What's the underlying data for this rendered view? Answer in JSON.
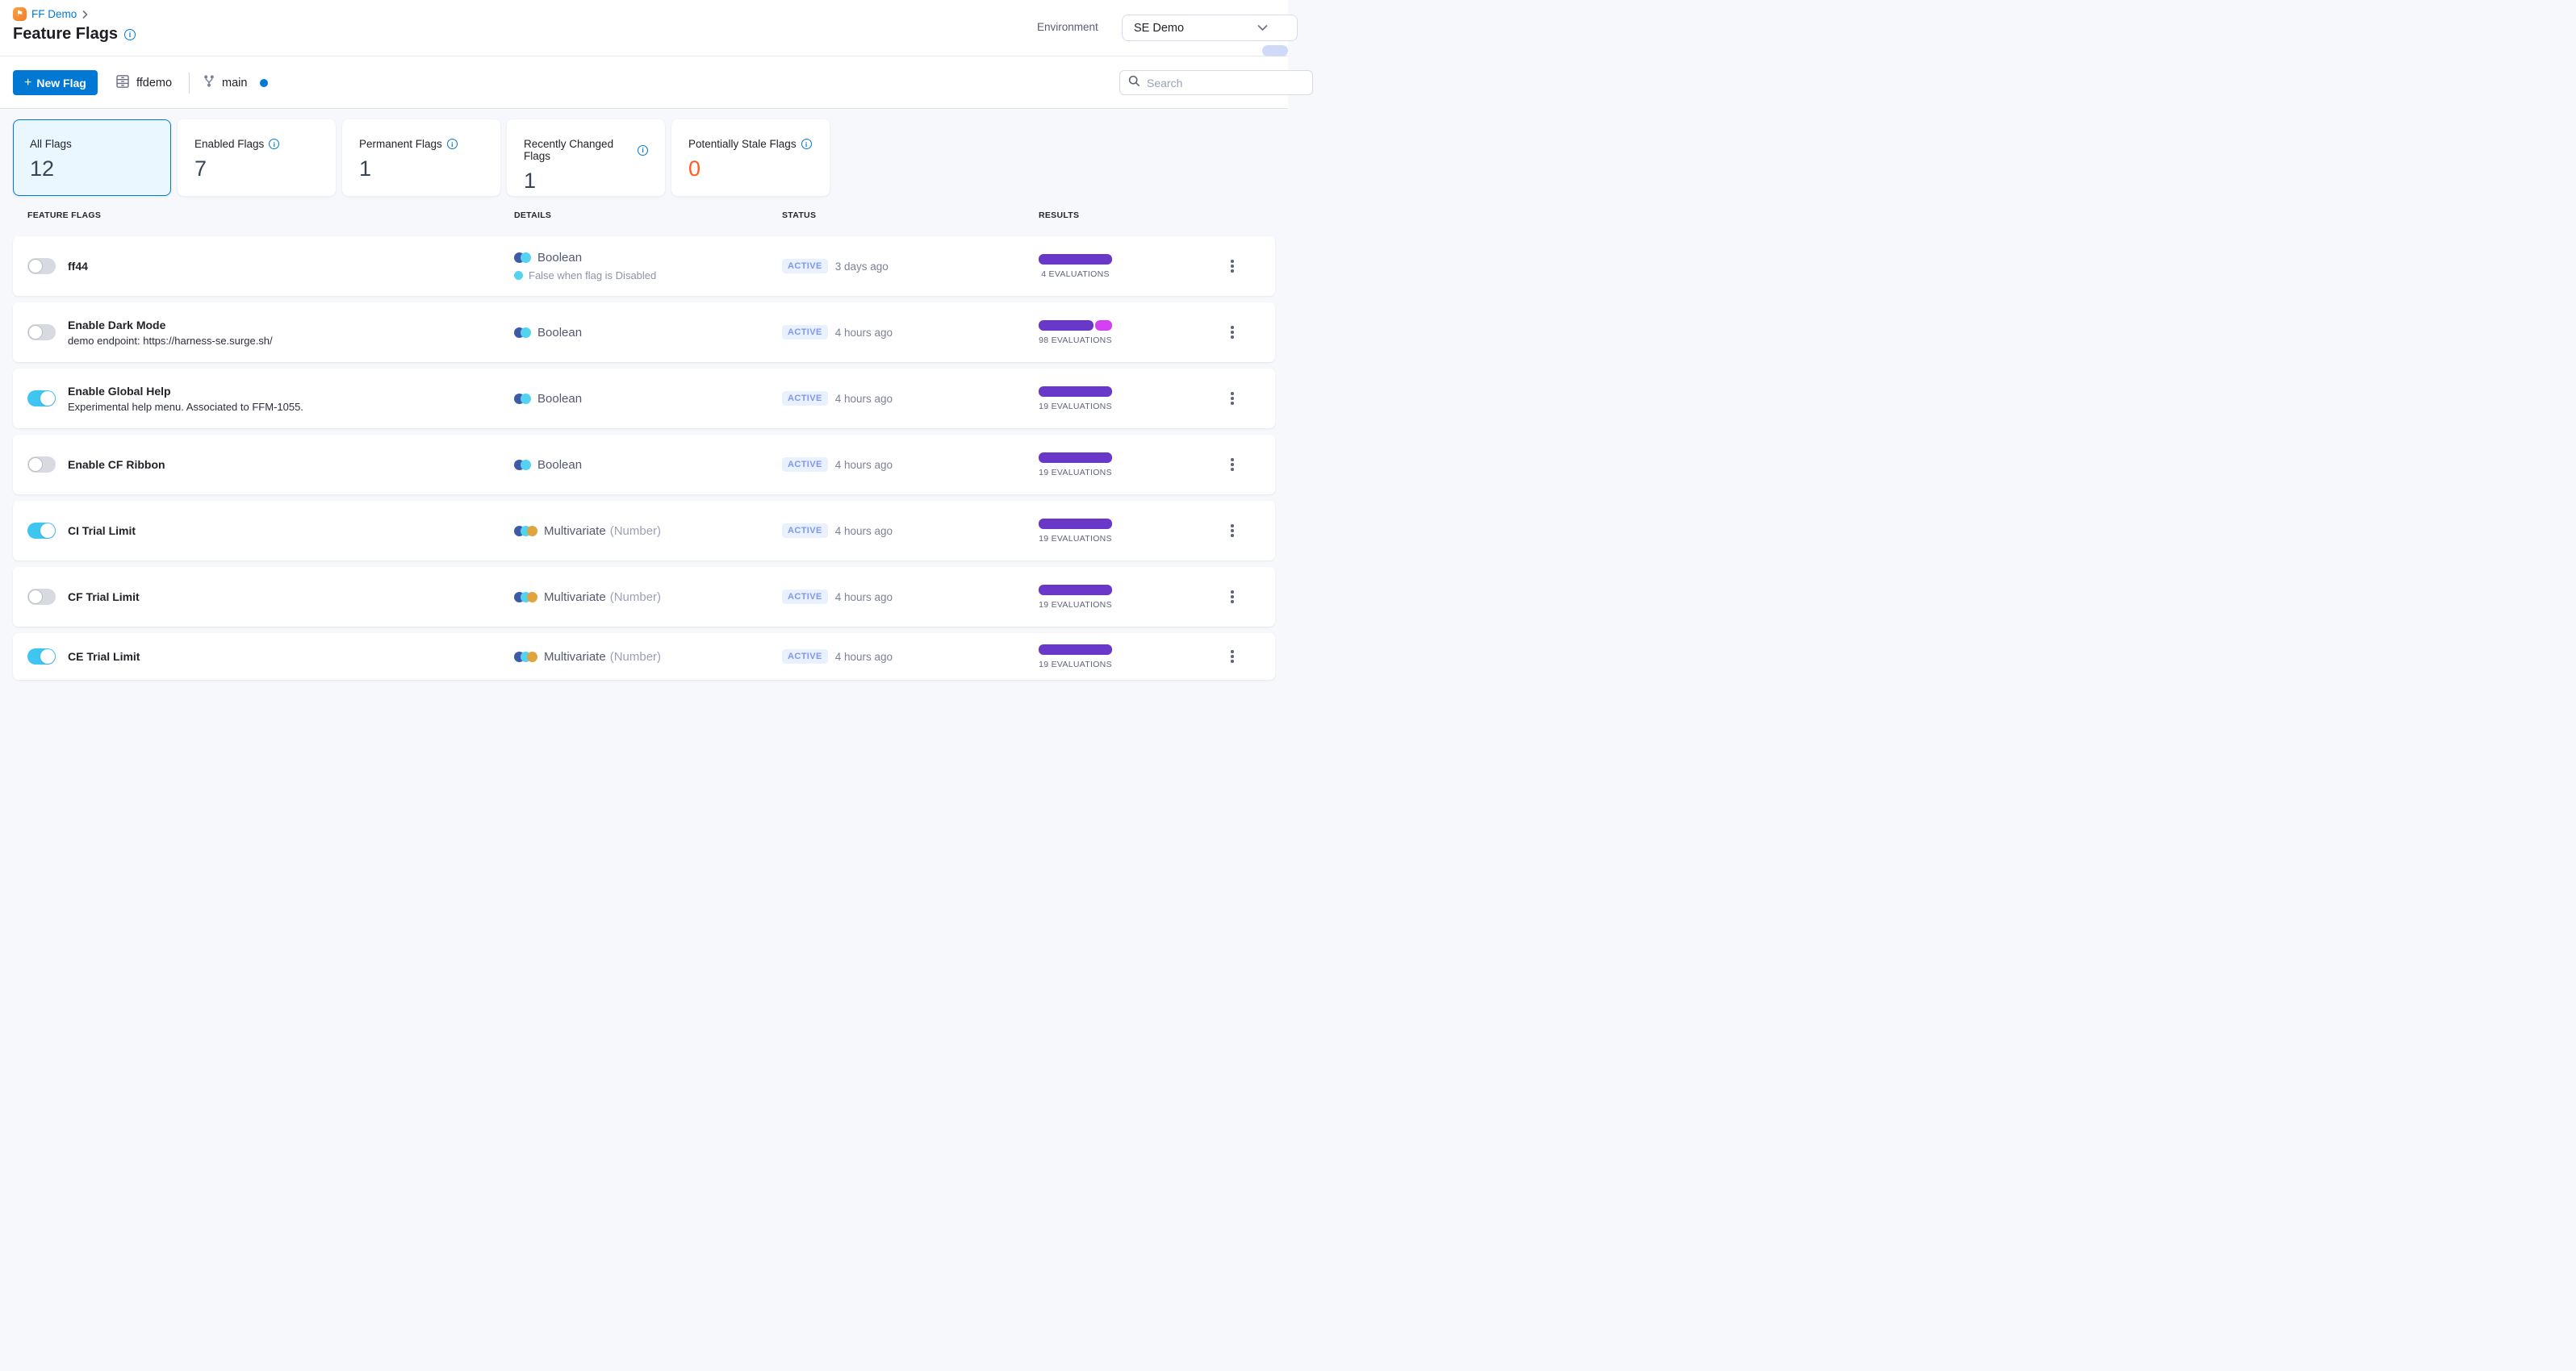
{
  "breadcrumb": {
    "project": "FF Demo"
  },
  "page": {
    "title": "Feature Flags"
  },
  "environment": {
    "label": "Environment",
    "value": "SE Demo"
  },
  "toolbar": {
    "new_flag_plus": "+",
    "new_flag_label": "New Flag",
    "repo": "ffdemo",
    "branch": "main",
    "search_placeholder": "Search"
  },
  "stats": [
    {
      "label": "All Flags",
      "value": "12",
      "selected": true
    },
    {
      "label": "Enabled Flags",
      "value": "7"
    },
    {
      "label": "Permanent Flags",
      "value": "1"
    },
    {
      "label": "Recently Changed Flags",
      "value": "1"
    },
    {
      "label": "Potentially Stale Flags",
      "value": "0",
      "value_color": "#ff5c1f"
    }
  ],
  "table": {
    "headers": [
      "FEATURE FLAGS",
      "DETAILS",
      "STATUS",
      "RESULTS"
    ],
    "rows": [
      {
        "name": "ff44",
        "desc": "",
        "toggle": "off",
        "type_kind": "boolean",
        "type_label": "Boolean",
        "type_suffix": "",
        "note": "False when flag is Disabled",
        "status": "ACTIVE",
        "time": "3 days ago",
        "evaluations": "4 EVALUATIONS",
        "bars": [
          {
            "width": 91,
            "color": "#6938c9"
          }
        ]
      },
      {
        "name": "Enable Dark Mode",
        "desc": "demo endpoint: https://harness-se.surge.sh/",
        "toggle": "off",
        "type_kind": "boolean",
        "type_label": "Boolean",
        "type_suffix": "",
        "note": "",
        "status": "ACTIVE",
        "time": "4 hours ago",
        "evaluations": "98 EVALUATIONS",
        "bars": [
          {
            "width": 68,
            "color": "#6938c9"
          },
          {
            "width": 21,
            "color": "#d540f2"
          }
        ]
      },
      {
        "name": "Enable Global Help",
        "desc": "Experimental help menu. Associated to FFM-1055.",
        "toggle": "on",
        "type_kind": "boolean",
        "type_label": "Boolean",
        "type_suffix": "",
        "note": "",
        "status": "ACTIVE",
        "time": "4 hours ago",
        "evaluations": "19 EVALUATIONS",
        "bars": [
          {
            "width": 91,
            "color": "#6938c9"
          }
        ]
      },
      {
        "name": "Enable CF Ribbon",
        "desc": "",
        "toggle": "off",
        "type_kind": "boolean",
        "type_label": "Boolean",
        "type_suffix": "",
        "note": "",
        "status": "ACTIVE",
        "time": "4 hours ago",
        "evaluations": "19 EVALUATIONS",
        "bars": [
          {
            "width": 91,
            "color": "#6938c9"
          }
        ]
      },
      {
        "name": "CI Trial Limit",
        "desc": "",
        "toggle": "on",
        "type_kind": "multivariate",
        "type_label": "Multivariate",
        "type_suffix": "(Number)",
        "note": "",
        "status": "ACTIVE",
        "time": "4 hours ago",
        "evaluations": "19 EVALUATIONS",
        "bars": [
          {
            "width": 91,
            "color": "#6938c9"
          }
        ]
      },
      {
        "name": "CF Trial Limit",
        "desc": "",
        "toggle": "off",
        "type_kind": "multivariate",
        "type_label": "Multivariate",
        "type_suffix": "(Number)",
        "note": "",
        "status": "ACTIVE",
        "time": "4 hours ago",
        "evaluations": "19 EVALUATIONS",
        "bars": [
          {
            "width": 91,
            "color": "#6938c9"
          }
        ]
      },
      {
        "name": "CE Trial Limit",
        "desc": "",
        "toggle": "on",
        "type_kind": "multivariate",
        "type_label": "Multivariate",
        "type_suffix": "(Number)",
        "note": "",
        "status": "ACTIVE",
        "time": "4 hours ago",
        "evaluations": "19 EVALUATIONS",
        "bars": [
          {
            "width": 91,
            "color": "#6938c9"
          }
        ]
      }
    ]
  },
  "colors": {
    "primary_blue": "#0278d5",
    "toggle_on": "#3fc5f1",
    "bar_purple": "#6938c9",
    "bar_magenta": "#d540f2",
    "stale_orange": "#ff5c1f",
    "active_badge_text": "#7e97f2",
    "active_badge_bg": "#e9f1fe"
  }
}
